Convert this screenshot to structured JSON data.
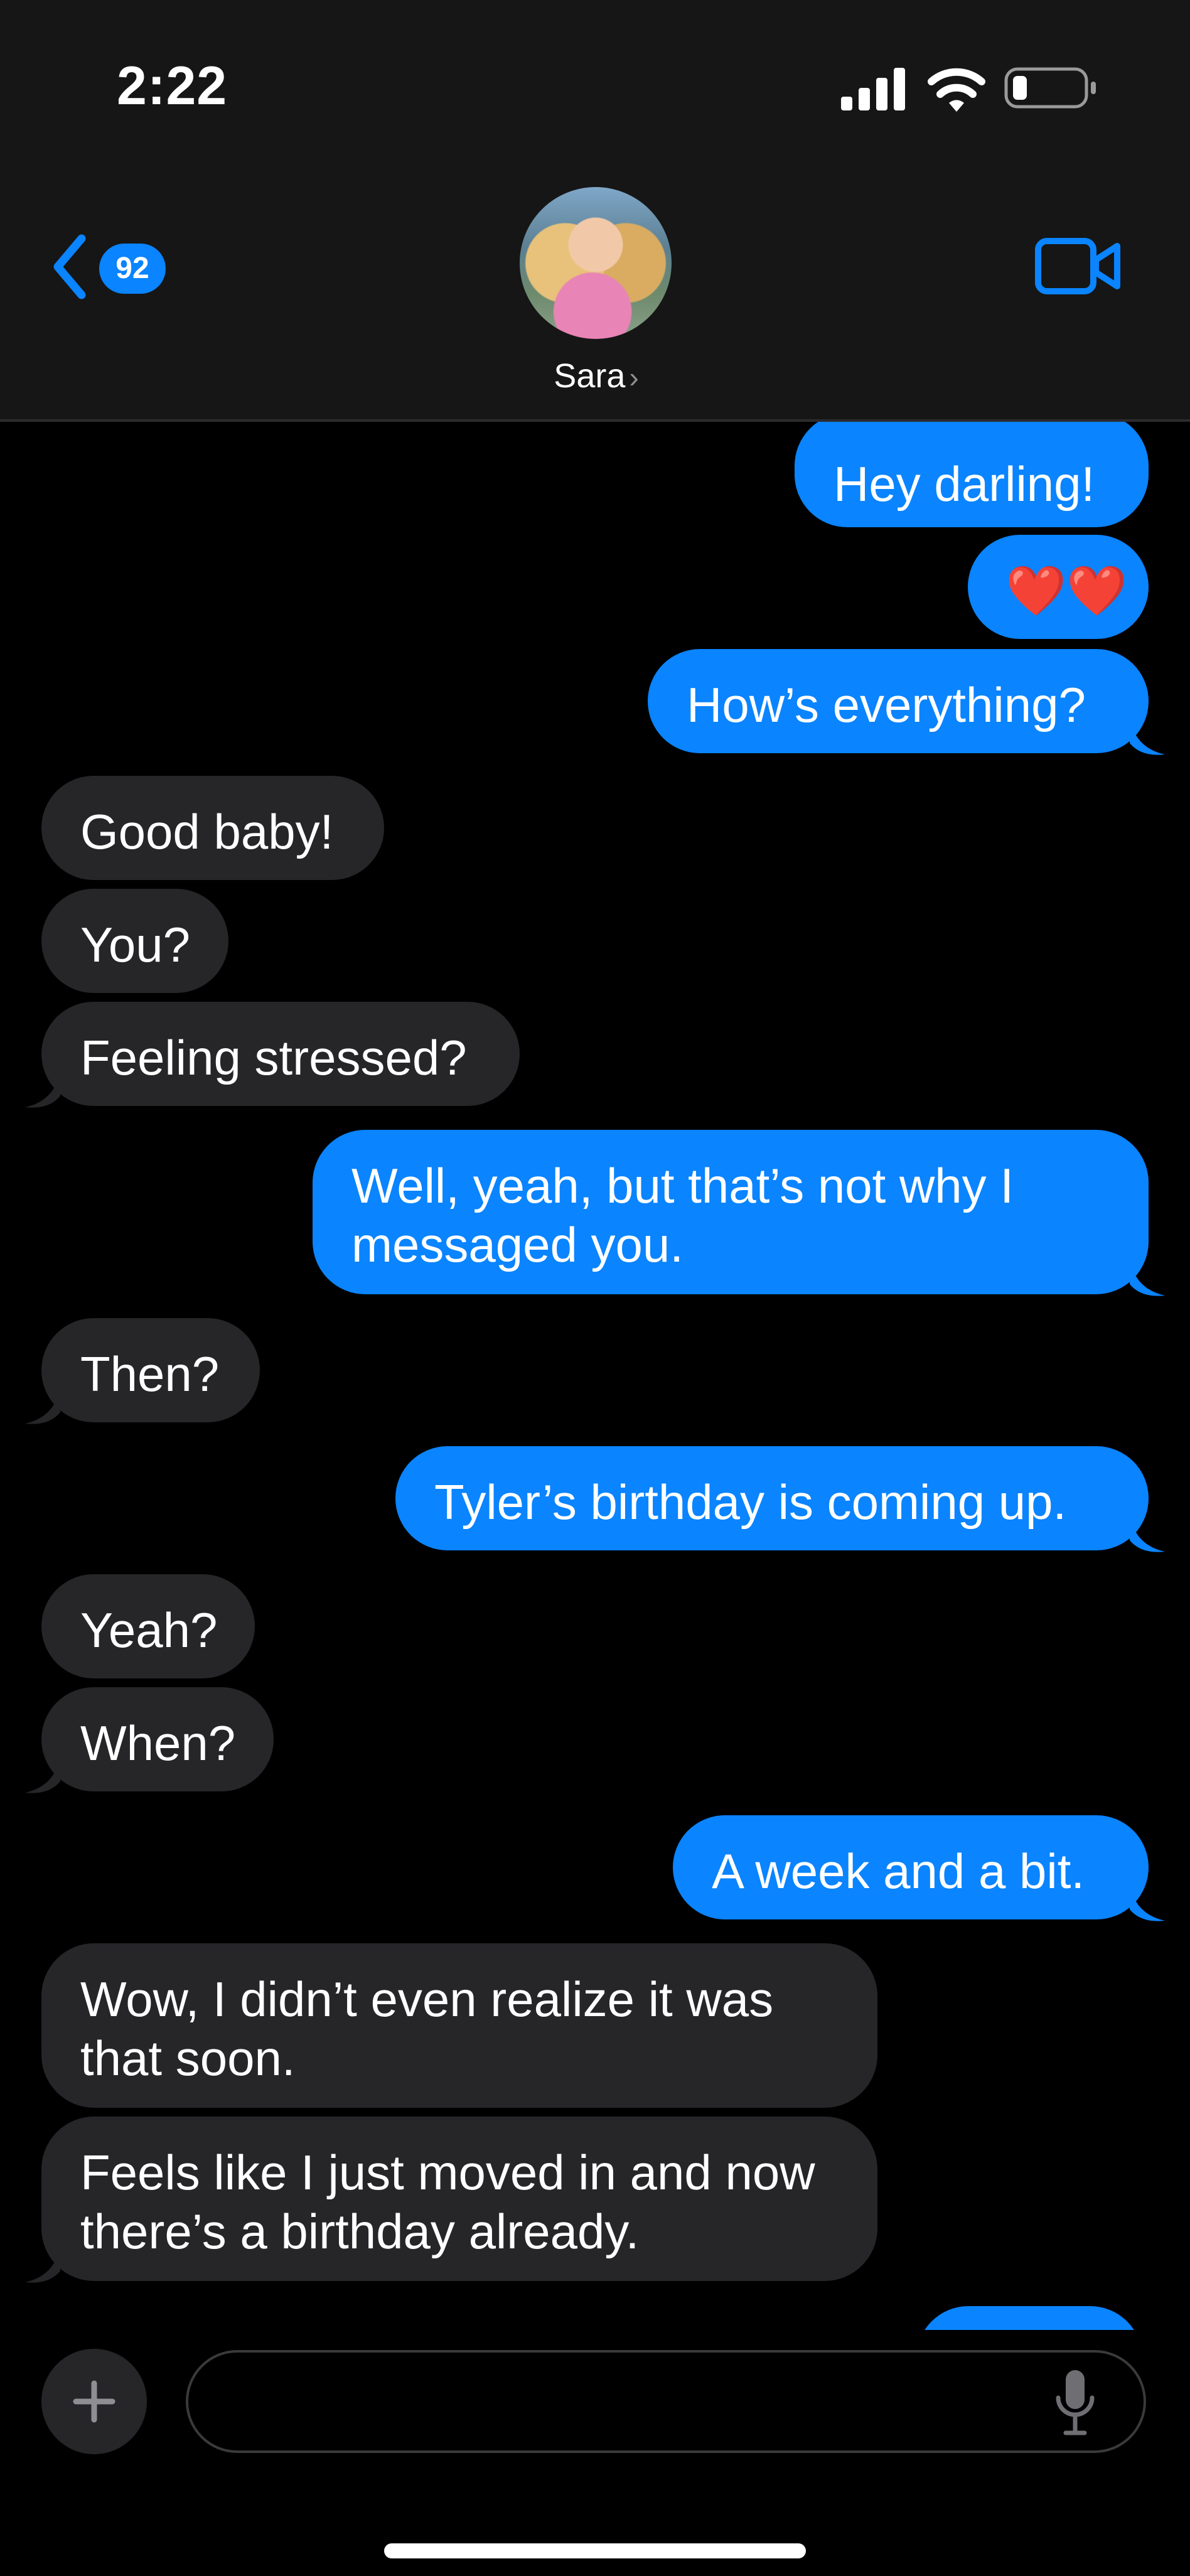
{
  "status": {
    "time": "2:22"
  },
  "header": {
    "unread_count": "92",
    "contact_name": "Sara",
    "contact_chevron": "›"
  },
  "messages": [
    {
      "text": "Hey darling!"
    },
    {
      "text": "❤️❤️"
    },
    {
      "text": "How’s everything?"
    },
    {
      "text": "Good baby!"
    },
    {
      "text": "You?"
    },
    {
      "text": "Feeling stressed?"
    },
    {
      "text": "Well, yeah, but that’s not why I messaged you."
    },
    {
      "text": "Then?"
    },
    {
      "text": "Tyler’s birthday is coming up."
    },
    {
      "text": "Yeah?"
    },
    {
      "text": "When?"
    },
    {
      "text": "A week and a bit."
    },
    {
      "text": "Wow, I didn’t even realize it was that soon."
    },
    {
      "text": "Feels like I just moved in and now there’s a birthday already."
    },
    {
      "text": ""
    }
  ],
  "composer": {
    "value": "",
    "placeholder": ""
  },
  "colors": {
    "sent_bubble": "#0a84ff",
    "received_bubble": "#262629",
    "background": "#000000",
    "header": "#161616"
  },
  "icons": {
    "back": "chevron-left-icon",
    "video": "video-camera-icon",
    "add": "plus-icon",
    "mic": "microphone-icon"
  }
}
